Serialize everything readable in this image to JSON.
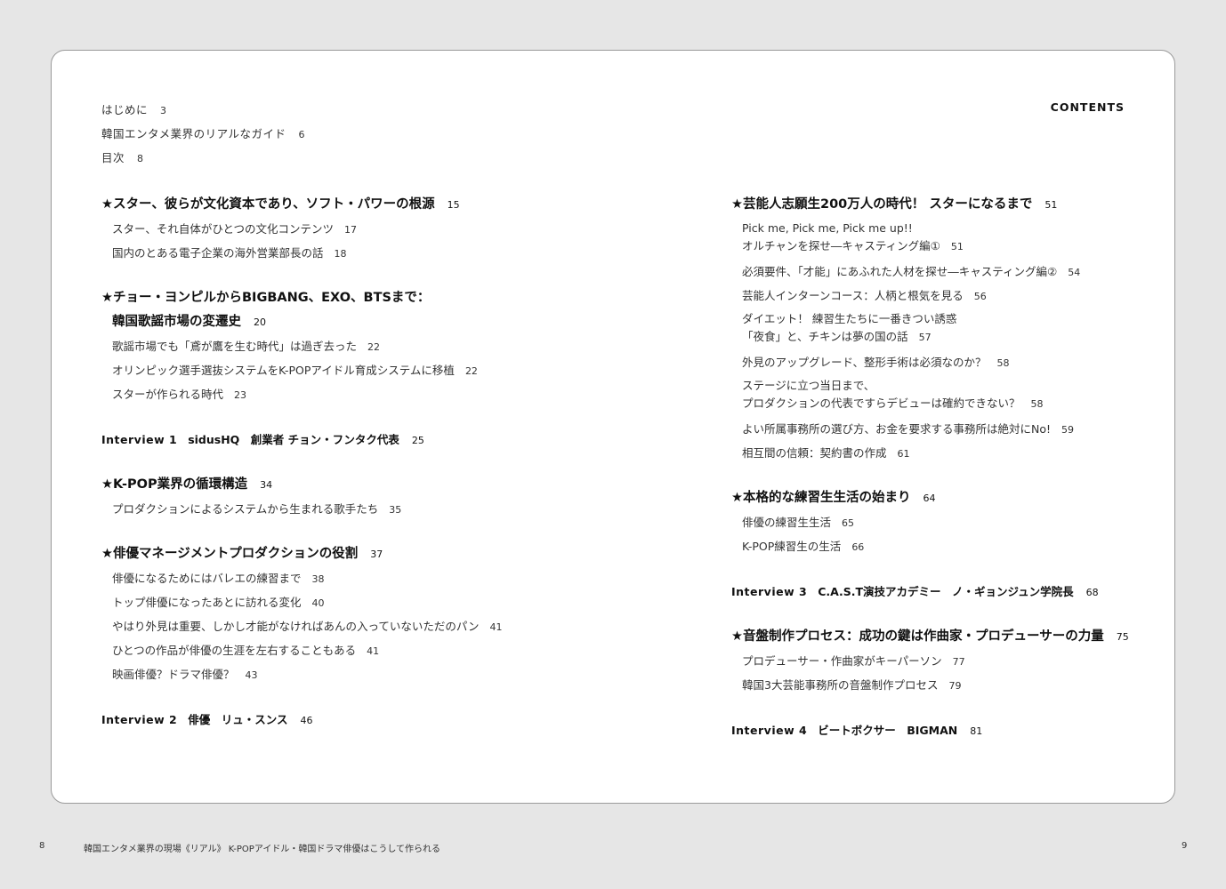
{
  "contents_label": "CONTENTS",
  "front_matter": [
    {
      "title": "はじめに",
      "page": "3"
    },
    {
      "title": "韓国エンタメ業界のリアルなガイド",
      "page": "6"
    },
    {
      "title": "目次",
      "page": "8"
    }
  ],
  "left_column": [
    {
      "type": "section",
      "lines": [
        "★スター、彼らが文化資本であり、ソフト・パワーの根源"
      ],
      "page": "15",
      "items": [
        {
          "lines": [
            "スター、それ自体がひとつの文化コンテンツ"
          ],
          "page": "17"
        },
        {
          "lines": [
            "国内のとある電子企業の海外営業部長の話"
          ],
          "page": "18"
        }
      ]
    },
    {
      "type": "section",
      "lines": [
        "★チョー・ヨンピルからBIGBANG、EXO、BTSまで：",
        "韓国歌謡市場の変遷史"
      ],
      "page": "20",
      "items": [
        {
          "lines": [
            "歌謡市場でも「鳶が鷹を生む時代」は過ぎ去った"
          ],
          "page": "22"
        },
        {
          "lines": [
            "オリンピック選手選抜システムをK-POPアイドル育成システムに移植"
          ],
          "page": "22"
        },
        {
          "lines": [
            "スターが作られる時代"
          ],
          "page": "23"
        }
      ]
    },
    {
      "type": "interview",
      "label": "Interview 1",
      "text": "sidusHQ　創業者 チョン・フンタク代表",
      "page": "25"
    },
    {
      "type": "section",
      "lines": [
        "★K-POP業界の循環構造"
      ],
      "page": "34",
      "items": [
        {
          "lines": [
            "プロダクションによるシステムから生まれる歌手たち"
          ],
          "page": "35"
        }
      ]
    },
    {
      "type": "section",
      "lines": [
        "★俳優マネージメントプロダクションの役割"
      ],
      "page": "37",
      "items": [
        {
          "lines": [
            "俳優になるためにはバレエの練習まで"
          ],
          "page": "38"
        },
        {
          "lines": [
            "トップ俳優になったあとに訪れる変化"
          ],
          "page": "40"
        },
        {
          "lines": [
            "やはり外見は重要、しかし才能がなければあんの入っていないただのパン"
          ],
          "page": "41"
        },
        {
          "lines": [
            "ひとつの作品が俳優の生涯を左右することもある"
          ],
          "page": "41"
        },
        {
          "lines": [
            "映画俳優？ドラマ俳優？"
          ],
          "page": "43"
        }
      ]
    },
    {
      "type": "interview",
      "label": "Interview 2",
      "text": "俳優　リュ・スンス",
      "page": "46"
    }
  ],
  "right_column": [
    {
      "type": "section",
      "lines": [
        "★芸能人志願生200万人の時代！ スターになるまで"
      ],
      "page": "51",
      "items": [
        {
          "lines": [
            "Pick me, Pick me, Pick me up!!",
            "オルチャンを探せ―キャスティング編①"
          ],
          "page": "51"
        },
        {
          "lines": [
            "必須要件、「才能」にあふれた人材を探せ―キャスティング編②"
          ],
          "page": "54"
        },
        {
          "lines": [
            "芸能人インターンコース：人柄と根気を見る"
          ],
          "page": "56"
        },
        {
          "lines": [
            "ダイエット！ 練習生たちに一番きつい誘惑",
            "「夜食」と、チキンは夢の国の話"
          ],
          "page": "57"
        },
        {
          "lines": [
            "外見のアップグレード、整形手術は必須なのか？"
          ],
          "page": "58"
        },
        {
          "lines": [
            "ステージに立つ当日まで、",
            "プロダクションの代表ですらデビューは確約できない？"
          ],
          "page": "58"
        },
        {
          "lines": [
            "よい所属事務所の選び方、お金を要求する事務所は絶対にNo!"
          ],
          "page": "59"
        },
        {
          "lines": [
            "相互間の信頼：契約書の作成"
          ],
          "page": "61"
        }
      ]
    },
    {
      "type": "section",
      "lines": [
        "★本格的な練習生生活の始まり"
      ],
      "page": "64",
      "items": [
        {
          "lines": [
            "俳優の練習生生活"
          ],
          "page": "65"
        },
        {
          "lines": [
            "K-POP練習生の生活"
          ],
          "page": "66"
        }
      ]
    },
    {
      "type": "interview",
      "label": "Interview 3",
      "text": "C.A.S.T演技アカデミー　ノ・ギョンジュン学院長",
      "page": "68"
    },
    {
      "type": "section",
      "lines": [
        "★音盤制作プロセス：成功の鍵は作曲家・プロデューサーの力量"
      ],
      "page": "75",
      "items": [
        {
          "lines": [
            "プロデューサー・作曲家がキーパーソン"
          ],
          "page": "77"
        },
        {
          "lines": [
            "韓国3大芸能事務所の音盤制作プロセス"
          ],
          "page": "79"
        }
      ]
    },
    {
      "type": "interview",
      "label": "Interview 4",
      "text": "ビートボクサー　BIGMAN",
      "page": "81"
    }
  ],
  "footer": {
    "page_left": "8",
    "running_title": "韓国エンタメ業界の現場《リアル》 K-POPアイドル・韓国ドラマ俳優はこうして作られる",
    "page_right": "9"
  }
}
